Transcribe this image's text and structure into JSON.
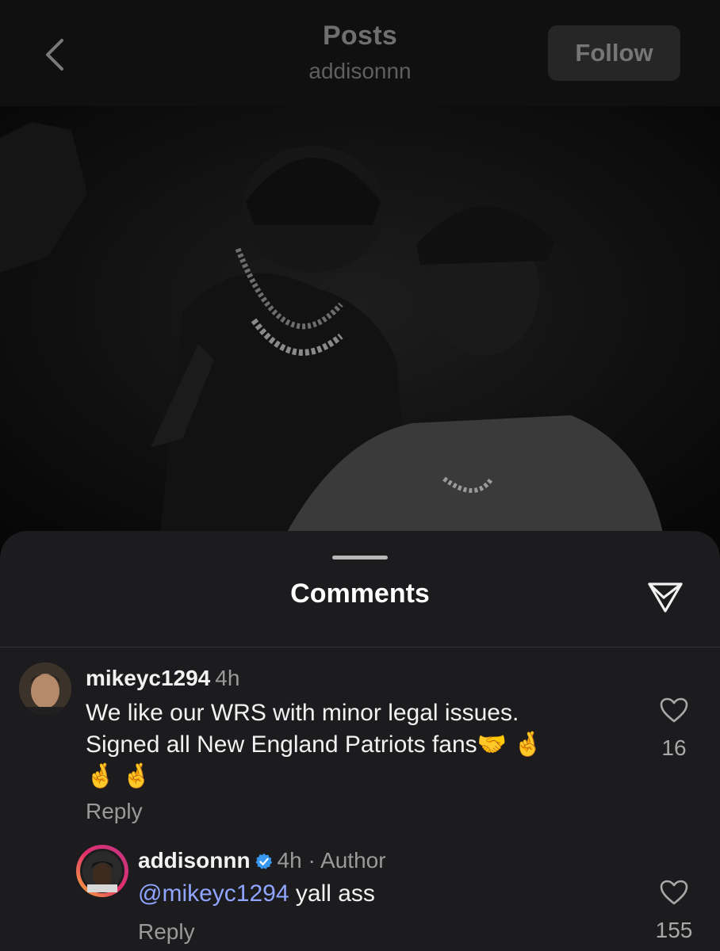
{
  "header": {
    "title": "Posts",
    "subtitle": "addisonnn",
    "follow_label": "Follow"
  },
  "photo": {
    "description_icon": "post-photo"
  },
  "comments_sheet": {
    "title": "Comments",
    "comments": [
      {
        "username": "mikeyc1294",
        "time": "4h",
        "text_line1": "We like our WRS with minor legal issues.",
        "text_line2": "Signed all New England Patriots fans",
        "emojis_line2": "🤝 🤞",
        "emojis_line3": "🤞 🤞",
        "reply_label": "Reply",
        "likes": "16"
      },
      {
        "username": "addisonnn",
        "time": "4h",
        "author_label": "· Author",
        "mention": "@mikeyc1294",
        "text": " yall ass",
        "reply_label": "Reply",
        "likes": "155"
      }
    ]
  },
  "colors": {
    "sheet_bg": "#1c1c1e",
    "mention": "#8fa5ff",
    "verified": "#3897f0"
  }
}
